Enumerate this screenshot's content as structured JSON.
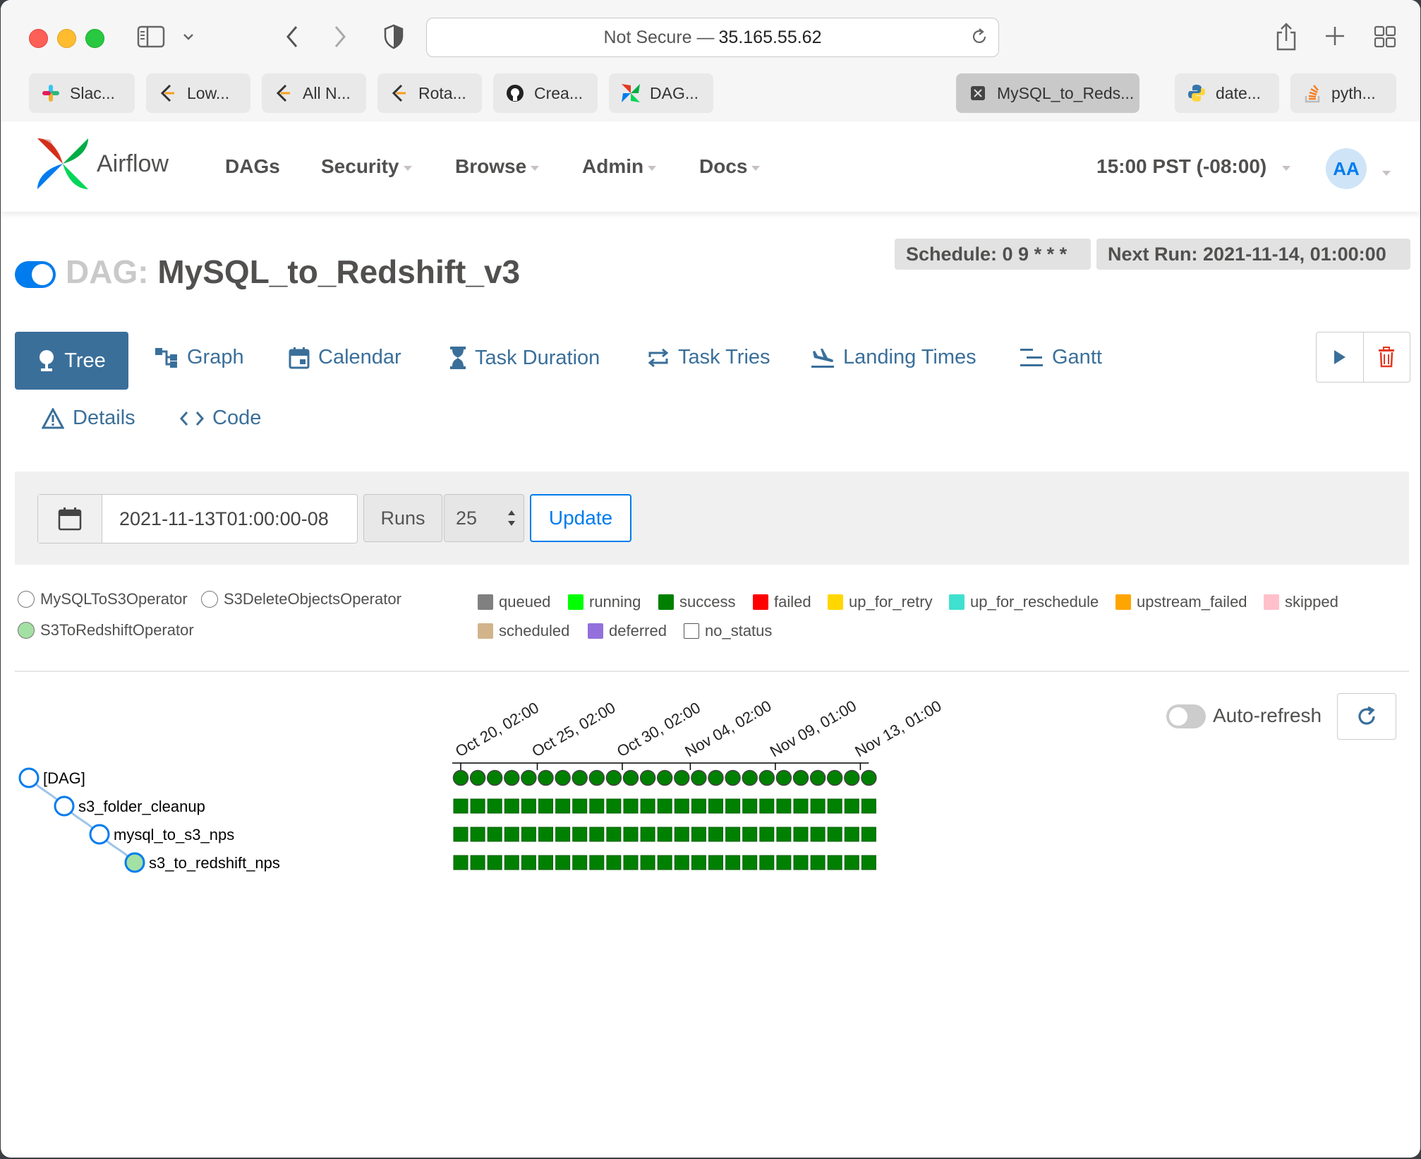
{
  "browser": {
    "url_prefix": "Not Secure —",
    "url_host": "35.165.55.62",
    "tabs": [
      {
        "label": "Slac...",
        "icon": "slack-icon"
      },
      {
        "label": "Low...",
        "icon": "leetcode-icon"
      },
      {
        "label": "All N...",
        "icon": "leetcode-icon"
      },
      {
        "label": "Rota...",
        "icon": "leetcode-icon"
      },
      {
        "label": "Crea...",
        "icon": "github-icon"
      },
      {
        "label": "DAG...",
        "icon": "airflow-icon"
      },
      {
        "label": "MySQL_to_Reds...",
        "icon": "close-icon",
        "active": true
      },
      {
        "label": "date...",
        "icon": "python-icon"
      },
      {
        "label": "pyth...",
        "icon": "stackoverflow-icon"
      }
    ]
  },
  "navbar": {
    "brand": "Airflow",
    "links": [
      "DAGs",
      "Security",
      "Browse",
      "Admin",
      "Docs"
    ],
    "timezone": "15:00 PST (-08:00)",
    "avatar": "AA"
  },
  "dag": {
    "prefix": "DAG:",
    "name": "MySQL_to_Redshift_v3",
    "schedule": "Schedule: 0 9 * * *",
    "next_run": "Next Run: 2021-11-14, 01:00:00",
    "paused": false
  },
  "views": {
    "tree": "Tree",
    "graph": "Graph",
    "calendar": "Calendar",
    "task_duration": "Task Duration",
    "task_tries": "Task Tries",
    "landing_times": "Landing Times",
    "gantt": "Gantt",
    "details": "Details",
    "code": "Code"
  },
  "filter": {
    "base_date": "2021-11-13T01:00:00-08",
    "runs_label": "Runs",
    "runs_value": "25",
    "update_label": "Update"
  },
  "operator_legend": [
    {
      "label": "MySQLToS3Operator",
      "color": "#ffffff"
    },
    {
      "label": "S3DeleteObjectsOperator",
      "color": "#ffffff"
    },
    {
      "label": "S3ToRedshiftOperator",
      "color": "#a3e0a3"
    }
  ],
  "state_legend": [
    {
      "label": "queued",
      "color": "#808080"
    },
    {
      "label": "running",
      "color": "#00ff00"
    },
    {
      "label": "success",
      "color": "#008000"
    },
    {
      "label": "failed",
      "color": "#ff0000"
    },
    {
      "label": "up_for_retry",
      "color": "#ffd700"
    },
    {
      "label": "up_for_reschedule",
      "color": "#40e0d0"
    },
    {
      "label": "upstream_failed",
      "color": "#ffa500"
    },
    {
      "label": "skipped",
      "color": "#ffc0cb"
    },
    {
      "label": "scheduled",
      "color": "#d2b48c"
    },
    {
      "label": "deferred",
      "color": "#9370db"
    },
    {
      "label": "no_status",
      "color": "#ffffff"
    }
  ],
  "auto_refresh": {
    "label": "Auto-refresh",
    "enabled": false
  },
  "tree": {
    "dates": [
      "Oct 20, 02:00",
      "Oct 25, 02:00",
      "Oct 30, 02:00",
      "Nov 04, 02:00",
      "Nov 09, 01:00",
      "Nov 13, 01:00"
    ],
    "nodes": [
      {
        "label": "[DAG]",
        "depth": 0,
        "color": "#ffffff"
      },
      {
        "label": "s3_folder_cleanup",
        "depth": 1,
        "color": "#ffffff"
      },
      {
        "label": "mysql_to_s3_nps",
        "depth": 2,
        "color": "#ffffff"
      },
      {
        "label": "s3_to_redshift_nps",
        "depth": 3,
        "color": "#a3e0a3"
      }
    ],
    "run_count": 25,
    "run_state": "success",
    "success_color": "#008000"
  }
}
